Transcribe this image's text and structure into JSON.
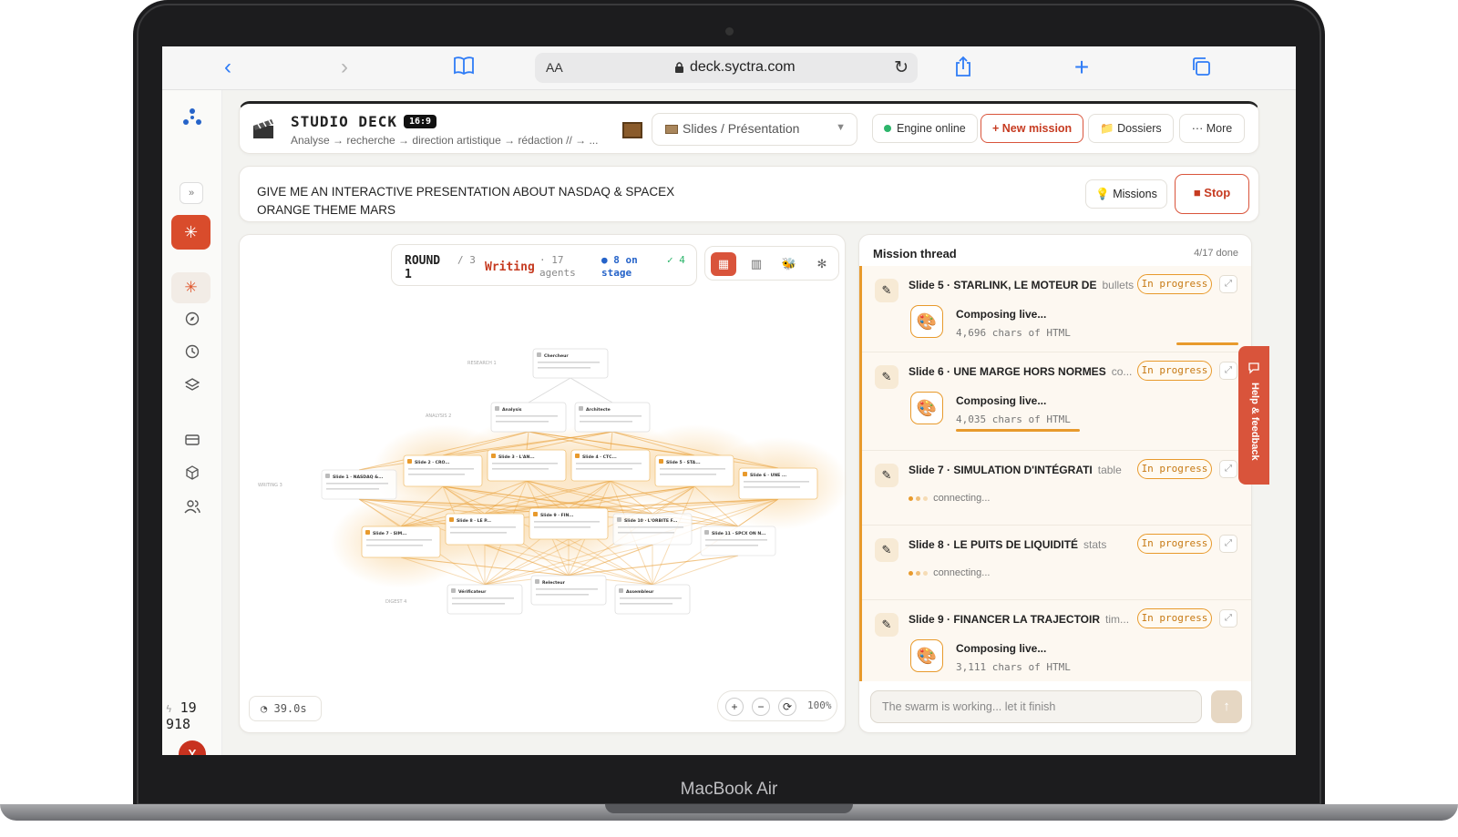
{
  "device": {
    "brand": "MacBook Air"
  },
  "browser": {
    "url": "deck.syctra.com",
    "reader_label": "AA"
  },
  "sidebar": {
    "expand_label": "»",
    "counter": "19 918",
    "avatar_initial": "Y"
  },
  "header": {
    "title": "STUDIO DECK",
    "ratio": "16:9",
    "subtitle": "Analyse → recherche → direction artistique → rédaction // → ...",
    "select_value": "Slides / Présentation",
    "engine_label": "Engine online",
    "new_mission_label": "+ New mission",
    "dossiers_label": "Dossiers",
    "more_label": "··· More"
  },
  "prompt": {
    "text": "GIVE ME AN INTERACTIVE PRESENTATION ABOUT NASDAQ & SPACEX\nORANGE THEME MARS",
    "missions_label": "Missions",
    "stop_label": "■ Stop"
  },
  "graph": {
    "round_label": "ROUND 1",
    "round_of": "/ 3",
    "status": "Writing",
    "agents": "· 17 agents",
    "on_stage": "● 8 on stage",
    "done": "✓ 4",
    "timer": "39.0s",
    "zoom": "100%",
    "lane_labels": [
      "RESEARCH 1",
      "ANALYSIS 2",
      "WRITING 3",
      "DIGEST 4"
    ],
    "node_titles": [
      "Chercheur",
      "Analysis",
      "Architecte",
      "Slide 1 · NASDAQ &...",
      "Slide 2 · CRO...",
      "Slide 3 · L'AN...",
      "Slide 4 · CTC...",
      "Slide 5 · STA...",
      "Slide 6 · UNE ...",
      "Slide 7 · SIM...",
      "Slide 8 · LE P...",
      "Slide 9 · FIN...",
      "Slide 10 · L'ORBITE F...",
      "Slide 11 · SPCX ON N...",
      "Vérificateur",
      "Relecteur",
      "Assembleur"
    ]
  },
  "thread": {
    "title": "Mission thread",
    "count": "4/17 done",
    "items": [
      {
        "title": "Slide 5 · STARLINK, LE MOTEUR DE",
        "kind": "bullets",
        "status": "In progress",
        "composing": "Composing live...",
        "chars": "4,696 chars of HTML",
        "progress": 0.22
      },
      {
        "title": "Slide 6 · UNE MARGE HORS NORMES",
        "kind": "co...",
        "status": "In progress",
        "composing": "Composing live...",
        "chars": "4,035 chars of HTML",
        "progress": 0.44
      },
      {
        "title": "Slide 7 · SIMULATION D'INTÉGRATI",
        "kind": "table",
        "status": "In progress",
        "connecting": "connecting..."
      },
      {
        "title": "Slide 8 · LE PUITS DE LIQUIDITÉ",
        "kind": "stats",
        "status": "In progress",
        "connecting": "connecting..."
      },
      {
        "title": "Slide 9 · FINANCER LA TRAJECTOIR",
        "kind": "tim...",
        "status": "In progress",
        "composing": "Composing live...",
        "chars": "3,111 chars of HTML"
      }
    ],
    "input_placeholder": "The swarm is working... let it finish",
    "send_label": "↑"
  },
  "help": {
    "label": "Help & feedback"
  },
  "colors": {
    "accent": "#d9543b",
    "progress": "#e89a2c",
    "online": "#2db56b"
  }
}
